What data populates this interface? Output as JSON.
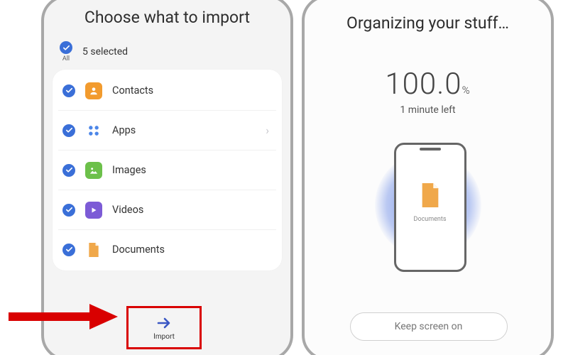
{
  "left": {
    "title": "Choose what to import",
    "all_label": "All",
    "selected_text": "5 selected",
    "items": [
      {
        "label": "Contacts",
        "icon": "contacts-icon"
      },
      {
        "label": "Apps",
        "icon": "apps-icon",
        "chevron": true
      },
      {
        "label": "Images",
        "icon": "images-icon"
      },
      {
        "label": "Videos",
        "icon": "videos-icon"
      },
      {
        "label": "Documents",
        "icon": "documents-icon"
      }
    ],
    "import_label": "Import"
  },
  "right": {
    "title": "Organizing your stuff…",
    "percent_value": "100.0",
    "percent_unit": "%",
    "time_left": "1 minute left",
    "current_item": "Documents",
    "keep_screen_label": "Keep screen on"
  }
}
